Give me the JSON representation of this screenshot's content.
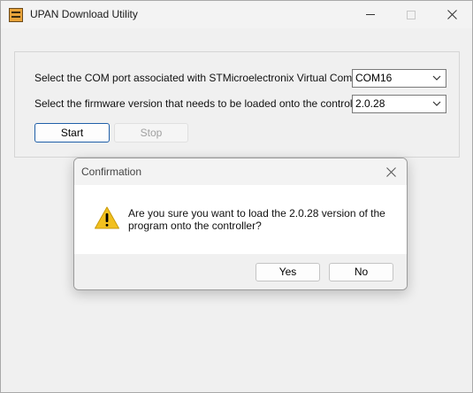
{
  "window": {
    "title": "UPAN Download Utility"
  },
  "form": {
    "com_label": "Select the COM port associated with STMicroelectronix Virtual Com Port:",
    "com_value": "COM16",
    "fw_label": "Select the firmware version that needs to be loaded onto the controller:",
    "fw_value": "2.0.28",
    "start_label": "Start",
    "stop_label": "Stop"
  },
  "dialog": {
    "title": "Confirmation",
    "message": "Are you sure you want to load the 2.0.28 version of the program onto the controller?",
    "yes_label": "Yes",
    "no_label": "No",
    "icon": "warning-icon"
  },
  "colors": {
    "accent": "#1f5fa8",
    "warning": "#f2c01e"
  }
}
